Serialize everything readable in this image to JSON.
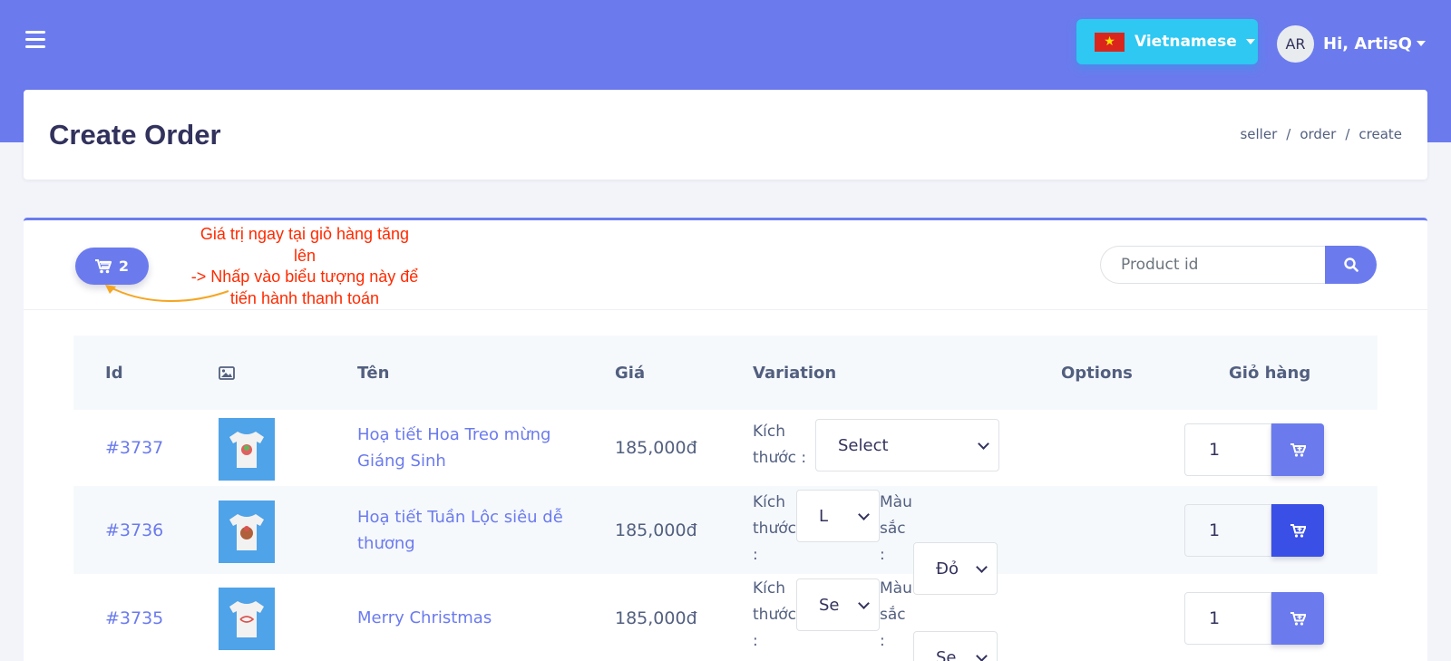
{
  "topbar": {
    "language": {
      "label": "Vietnamese"
    },
    "user": {
      "initials": "AR",
      "greeting": "Hi, ArtisQ"
    }
  },
  "header": {
    "title": "Create Order",
    "breadcrumb": [
      "seller",
      "order",
      "create"
    ]
  },
  "cart": {
    "count": "2"
  },
  "annotation": {
    "lines": [
      "Giá trị ngay tại giỏ hàng tăng",
      "lên",
      "-> Nhấp vào biểu tượng này để",
      "tiến hành thanh toán"
    ],
    "color": "#ff2a00",
    "arrow_color": "#f5a623"
  },
  "search": {
    "placeholder": "Product id"
  },
  "table": {
    "headers": {
      "id": "Id",
      "image_icon": "image-icon",
      "name": "Tên",
      "price": "Giá",
      "variation": "Variation",
      "options": "Options",
      "cart": "Giỏ hàng"
    },
    "rows": [
      {
        "id": "#3737",
        "name": "Hoạ tiết Hoa Treo mừng Giáng Sinh",
        "price": "185,000đ",
        "size_label": "Kích thước :",
        "size_value": "Select",
        "color_label": "",
        "color_value": "",
        "qty": "1"
      },
      {
        "id": "#3736",
        "name": "Hoạ tiết Tuần Lộc siêu dễ thương",
        "price": "185,000đ",
        "size_label": "Kích thước :",
        "size_value": "L",
        "color_label": "Màu sắc :",
        "color_value": "Đỏ",
        "qty": "1"
      },
      {
        "id": "#3735",
        "name": "Merry Christmas",
        "price": "185,000đ",
        "size_label": "Kích thước :",
        "size_value": "Se",
        "color_label": "Màu sắc :",
        "color_value": "Se",
        "qty": "1"
      }
    ]
  },
  "colors": {
    "primary": "#6b7bee",
    "accent": "#2ec8f2",
    "active_cart": "#3a4fe6"
  }
}
